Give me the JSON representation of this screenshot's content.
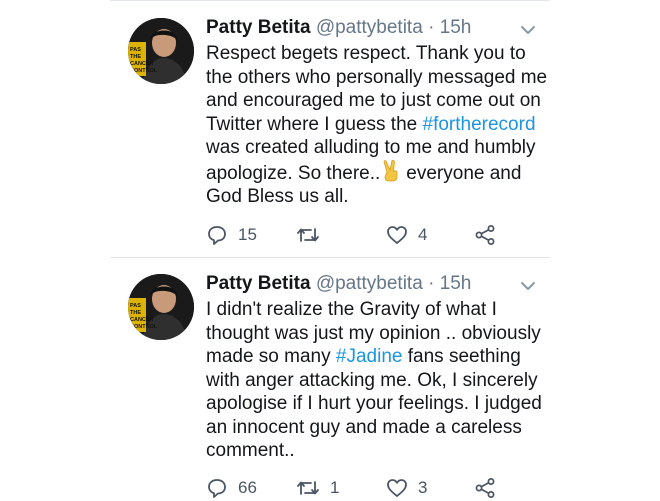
{
  "tweets": [
    {
      "author_name": "Patty Betita",
      "handle": "@pattybetita",
      "separator": "·",
      "time": "15h",
      "lines": [
        {
          "text": "Respect begets respect. Thank you to"
        },
        {
          "text": "the others who personally messaged me"
        },
        {
          "text": "and encouraged me to just come out on"
        },
        {
          "pre": "Twitter where I guess the ",
          "hashtag": "#fortherecord"
        },
        {
          "text": "was created alluding to me and humbly"
        },
        {
          "pre": "apologize. So there..",
          "emoji": "victory-hand-icon",
          "post": "everyone and"
        },
        {
          "text": "God Bless us all."
        }
      ],
      "replies": "15",
      "retweets": "",
      "likes": "4"
    },
    {
      "author_name": "Patty Betita",
      "handle": "@pattybetita",
      "separator": "·",
      "time": "15h",
      "lines": [
        {
          "text": "I didn't realize the Gravity of what I"
        },
        {
          "text": "thought was just my opinion .. obviously"
        },
        {
          "pre": "made so many ",
          "hashtag": "#Jadine",
          "post": " fans seething"
        },
        {
          "text": "with anger attacking me. Ok, I sincerely"
        },
        {
          "text": "apologise if I hurt your feelings. I judged"
        },
        {
          "text": "an innocent guy and made a careless"
        },
        {
          "text": "comment.."
        }
      ],
      "replies": "66",
      "retweets": "1",
      "likes": "3"
    }
  ],
  "avatar_badge": [
    "PAS",
    "THE",
    "CANCER",
    "CONTROL"
  ],
  "colors": {
    "text": "#14171a",
    "muted": "#657786",
    "link": "#1b95e0",
    "icon": "#4b5563",
    "divider": "#e3e6ea"
  }
}
